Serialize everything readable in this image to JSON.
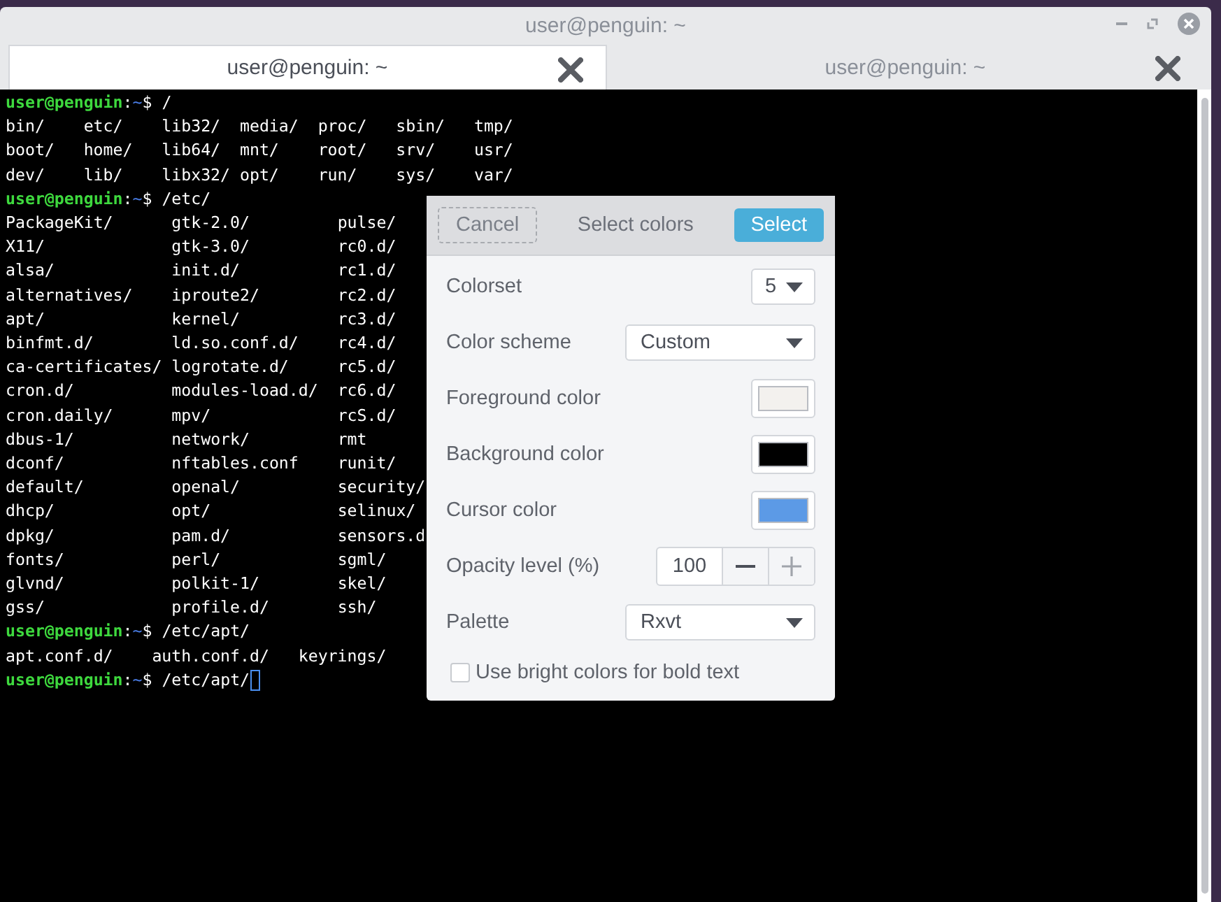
{
  "window": {
    "title": "user@penguin: ~"
  },
  "tabs": [
    {
      "label": "user@penguin: ~",
      "selected": true
    },
    {
      "label": "user@penguin: ~",
      "selected": false
    }
  ],
  "terminal": {
    "lines": [
      {
        "kind": "prompt",
        "user": "user@penguin",
        "colon": ":",
        "path": "~",
        "dollar": "$",
        "command": "/"
      },
      {
        "kind": "listing",
        "rows": [
          [
            "bin/",
            "etc/",
            "lib32/",
            "media/",
            "proc/",
            "sbin/",
            "tmp/"
          ],
          [
            "boot/",
            "home/",
            "lib64/",
            "mnt/",
            "root/",
            "srv/",
            "usr/"
          ],
          [
            "dev/",
            "lib/",
            "libx32/",
            "opt/",
            "run/",
            "sys/",
            "var/"
          ]
        ]
      },
      {
        "kind": "prompt",
        "user": "user@penguin",
        "colon": ":",
        "path": "~",
        "dollar": "$",
        "command": "/etc/"
      },
      {
        "kind": "listing",
        "rows": [
          [
            "PackageKit/",
            "gtk-2.0/",
            "pulse/"
          ],
          [
            "X11/",
            "gtk-3.0/",
            "rc0.d/"
          ],
          [
            "alsa/",
            "init.d/",
            "rc1.d/"
          ],
          [
            "alternatives/",
            "iproute2/",
            "rc2.d/"
          ],
          [
            "apt/",
            "kernel/",
            "rc3.d/"
          ],
          [
            "binfmt.d/",
            "ld.so.conf.d/",
            "rc4.d/"
          ],
          [
            "ca-certificates/",
            "logrotate.d/",
            "rc5.d/"
          ],
          [
            "cron.d/",
            "modules-load.d/",
            "rc6.d/"
          ],
          [
            "cron.daily/",
            "mpv/",
            "rcS.d/"
          ],
          [
            "dbus-1/",
            "network/",
            "rmt"
          ],
          [
            "dconf/",
            "nftables.conf",
            "runit/"
          ],
          [
            "default/",
            "openal/",
            "security/"
          ],
          [
            "dhcp/",
            "opt/",
            "selinux/"
          ],
          [
            "dpkg/",
            "pam.d/",
            "sensors.d"
          ],
          [
            "fonts/",
            "perl/",
            "sgml/"
          ],
          [
            "glvnd/",
            "polkit-1/",
            "skel/"
          ],
          [
            "gss/",
            "profile.d/",
            "ssh/"
          ]
        ]
      },
      {
        "kind": "prompt",
        "user": "user@penguin",
        "colon": ":",
        "path": "~",
        "dollar": "$",
        "command": "/etc/apt/"
      },
      {
        "kind": "listing",
        "rows": [
          [
            "apt.conf.d/",
            "auth.conf.d/",
            "keyrings/"
          ]
        ]
      },
      {
        "kind": "prompt",
        "user": "user@penguin",
        "colon": ":",
        "path": "~",
        "dollar": "$",
        "command": "/etc/apt/",
        "cursor": true
      }
    ]
  },
  "dialog": {
    "title": "Select colors",
    "cancel": "Cancel",
    "confirm": "Select",
    "rows": [
      {
        "kind": "small_select",
        "label": "Colorset",
        "value": "5"
      },
      {
        "kind": "select",
        "label": "Color scheme",
        "value": "Custom"
      },
      {
        "kind": "color",
        "label": "Foreground color",
        "color": "#f3f1ee"
      },
      {
        "kind": "color",
        "label": "Background color",
        "color": "#000000"
      },
      {
        "kind": "color",
        "label": "Cursor color",
        "color": "#5c9ae6"
      },
      {
        "kind": "spin",
        "label": "Opacity level (%)",
        "value": "100"
      },
      {
        "kind": "select",
        "label": "Palette",
        "value": "Rxvt"
      },
      {
        "kind": "checkbox",
        "label": "Use bright colors for bold text",
        "checked": false
      }
    ]
  }
}
